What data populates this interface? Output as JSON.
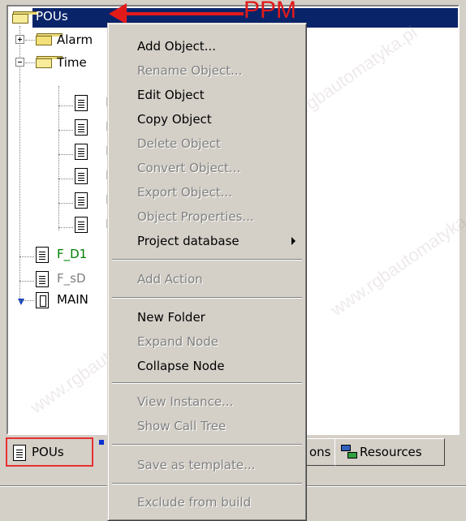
{
  "annotation": {
    "text": "PPM",
    "color": "#e21a1a"
  },
  "tree": {
    "root": {
      "label": "POUs",
      "selected": true
    },
    "items": [
      {
        "label": "Alarm",
        "type": "folder",
        "expander": "plus"
      },
      {
        "label": "Time",
        "type": "folder",
        "expander": "minus"
      },
      {
        "label": "F",
        "type": "doc"
      },
      {
        "label": "F",
        "type": "doc"
      },
      {
        "label": "F",
        "type": "doc"
      },
      {
        "label": "F",
        "type": "doc"
      },
      {
        "label": "F",
        "type": "doc"
      },
      {
        "label": "F",
        "type": "doc"
      },
      {
        "label": "F_D1",
        "type": "doc",
        "color": "#008000"
      },
      {
        "label": "F_sD",
        "type": "doc",
        "color": "#808080"
      },
      {
        "label": "MAIN",
        "type": "main"
      }
    ]
  },
  "context_menu": {
    "items": [
      {
        "label": "Add Object...",
        "enabled": true
      },
      {
        "label": "Rename Object...",
        "enabled": false
      },
      {
        "label": "Edit Object",
        "enabled": true
      },
      {
        "label": "Copy Object",
        "enabled": true
      },
      {
        "label": "Delete Object",
        "enabled": false
      },
      {
        "label": "Convert Object...",
        "enabled": false
      },
      {
        "label": "Export Object...",
        "enabled": false
      },
      {
        "label": "Object Properties...",
        "enabled": false
      },
      {
        "label": "Project database",
        "enabled": true,
        "submenu": true
      },
      {
        "label": "Add Action",
        "enabled": false
      },
      {
        "label": "New Folder",
        "enabled": true
      },
      {
        "label": "Expand Node",
        "enabled": false
      },
      {
        "label": "Collapse Node",
        "enabled": true
      },
      {
        "label": "View Instance...",
        "enabled": false
      },
      {
        "label": "Show Call Tree",
        "enabled": false
      },
      {
        "label": "Save as template...",
        "enabled": false
      },
      {
        "label": "Exclude from build",
        "enabled": false
      }
    ]
  },
  "tabs": {
    "pous": "POUs",
    "partial": "ons",
    "resources": "Resources"
  },
  "watermark": "www.rgbautomatyka.pl"
}
